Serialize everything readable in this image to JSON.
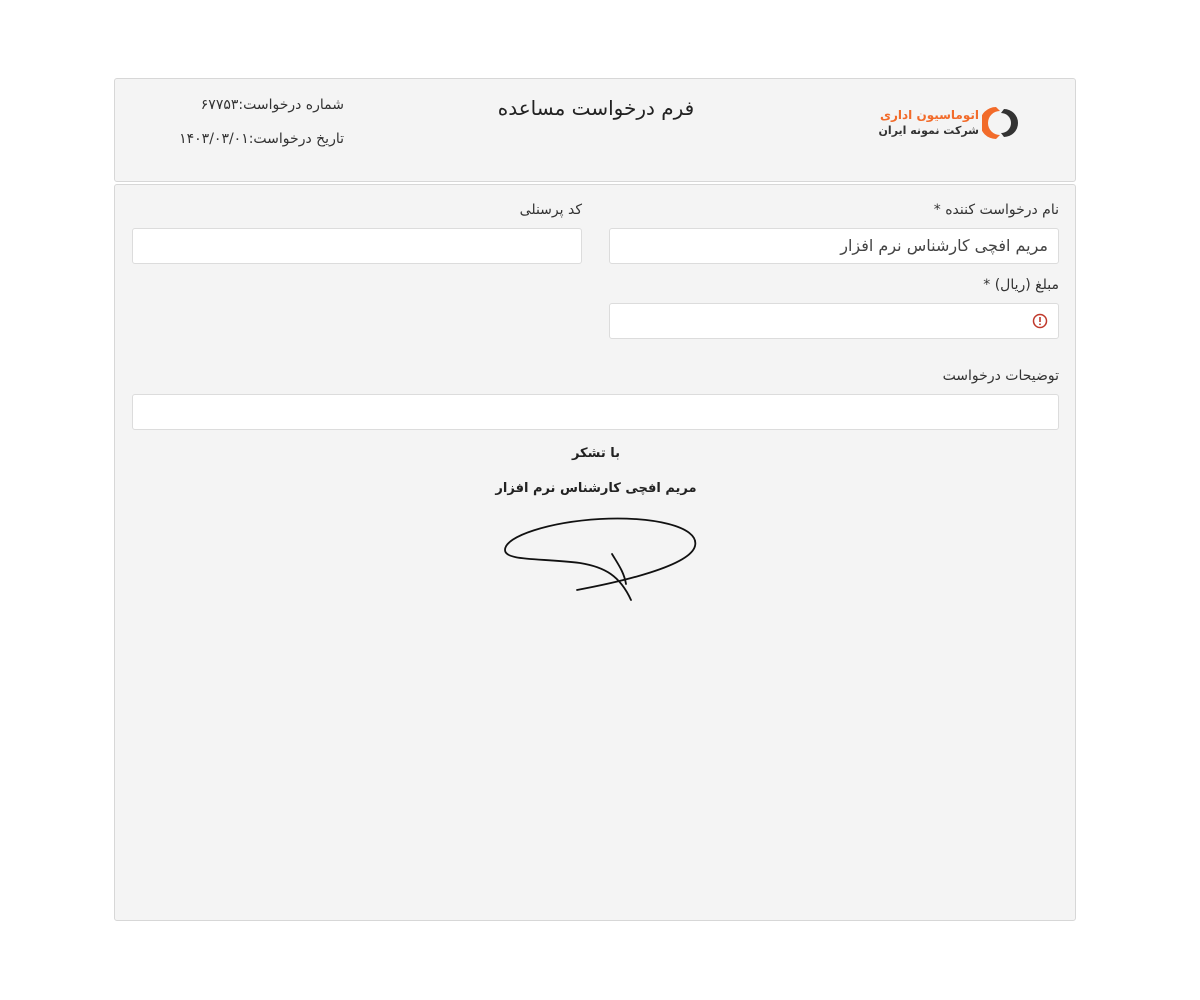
{
  "header": {
    "title": "فرم درخواست مساعده",
    "request_number": "شماره درخواست:۶۷۷۵۳",
    "request_date": "تاریخ درخواست:۱۴۰۳/۰۳/۰۱",
    "logo": {
      "line1": "اتوماسیون اداری",
      "line2": "شرکت نمونه ایران",
      "brand_color": "#f26b2a"
    }
  },
  "form": {
    "requester_name_label": "نام درخواست کننده *",
    "requester_name_value": "مریم افچی کارشناس نرم افزار",
    "personnel_code_label": "کد پرسنلی",
    "personnel_code_value": "",
    "amount_label": "مبلغ (ریال) *",
    "amount_value": "",
    "amount_error_icon": "error-circle-icon",
    "description_label": "توضیحات درخواست",
    "description_value": ""
  },
  "footer": {
    "thanks": "با تشکر",
    "signer": "مریم افچی کارشناس نرم افزار"
  },
  "colors": {
    "card_bg": "#f4f4f4",
    "border": "#d7d7d7",
    "error": "#c0392b"
  }
}
